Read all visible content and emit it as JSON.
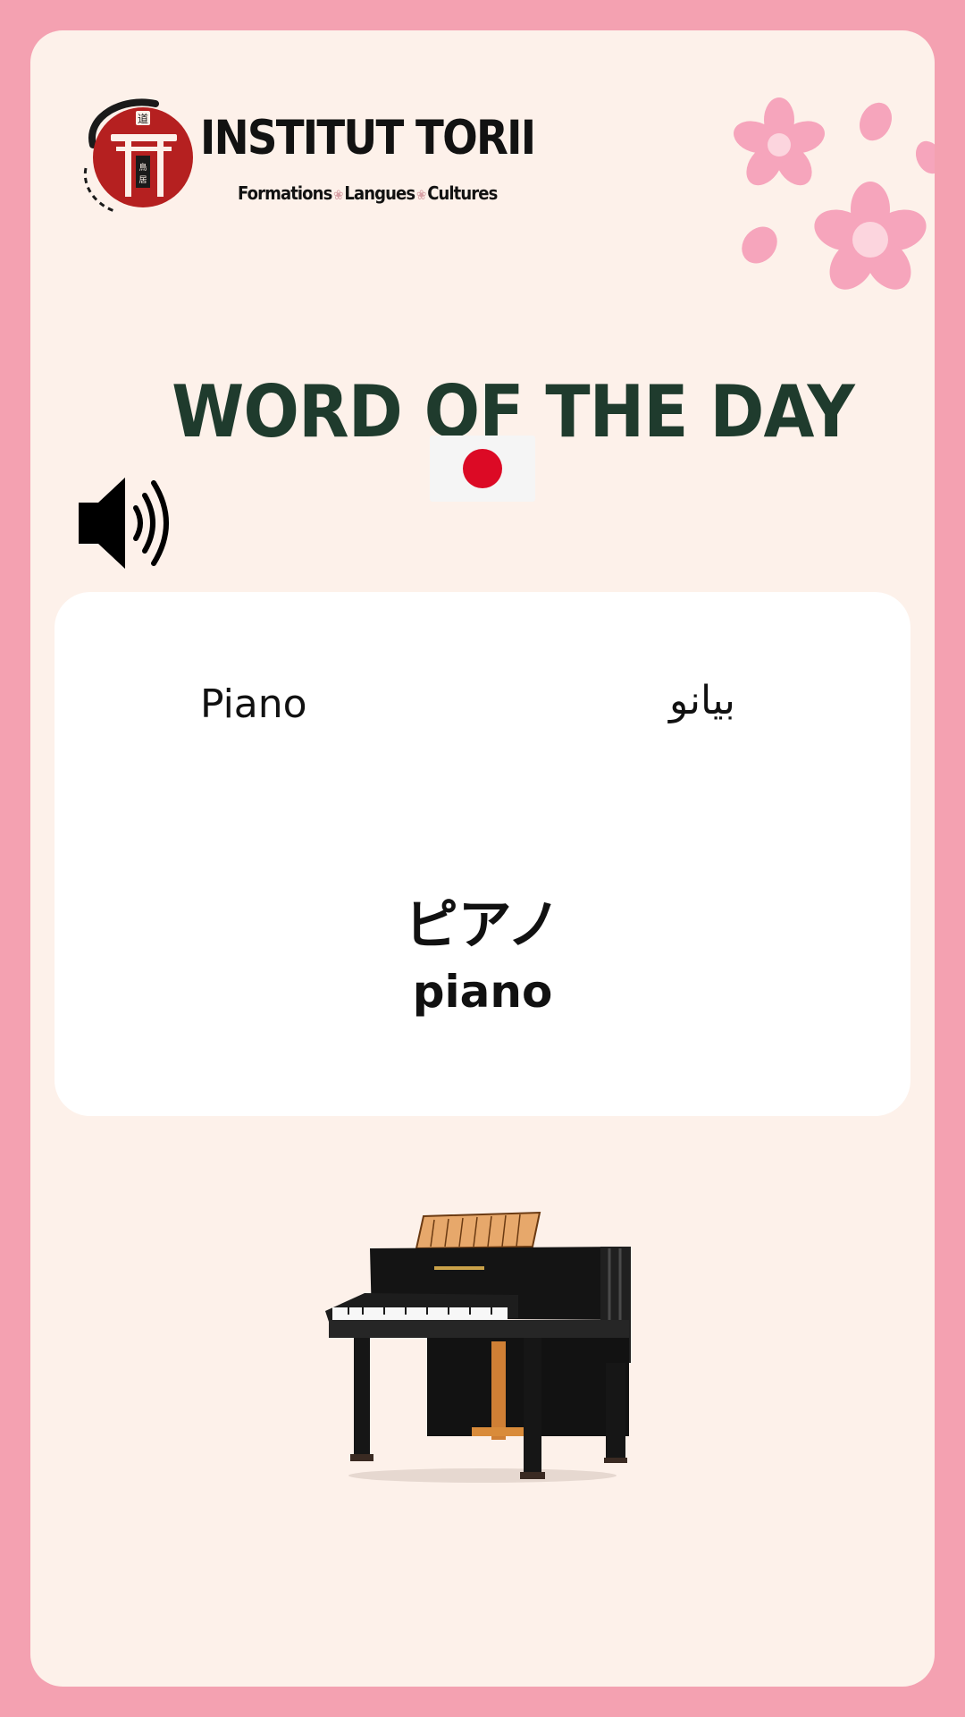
{
  "brand": {
    "name": "INSTITUT TORII",
    "tagline_parts": [
      "Formations",
      "Langues",
      "Cultures"
    ],
    "logo_glyph": "道",
    "logo_sub_glyphs": "鳥居"
  },
  "title": "WORD OF THE DAY",
  "flag": {
    "country": "Japan",
    "icon": "japan-flag-icon"
  },
  "audio": {
    "icon": "speaker-icon"
  },
  "word": {
    "french": "Piano",
    "arabic": "بيانو",
    "japanese": "ピアノ",
    "romaji": "piano"
  },
  "illustration": {
    "subject": "grand-piano",
    "icon": "piano-icon"
  },
  "colors": {
    "frame": "#f4a1b1",
    "card_background": "#fdf1ea",
    "title": "#1f3b2d",
    "flag_red": "#dc0a25",
    "sakura": "#f6a5bc",
    "logo_red": "#b52020"
  }
}
